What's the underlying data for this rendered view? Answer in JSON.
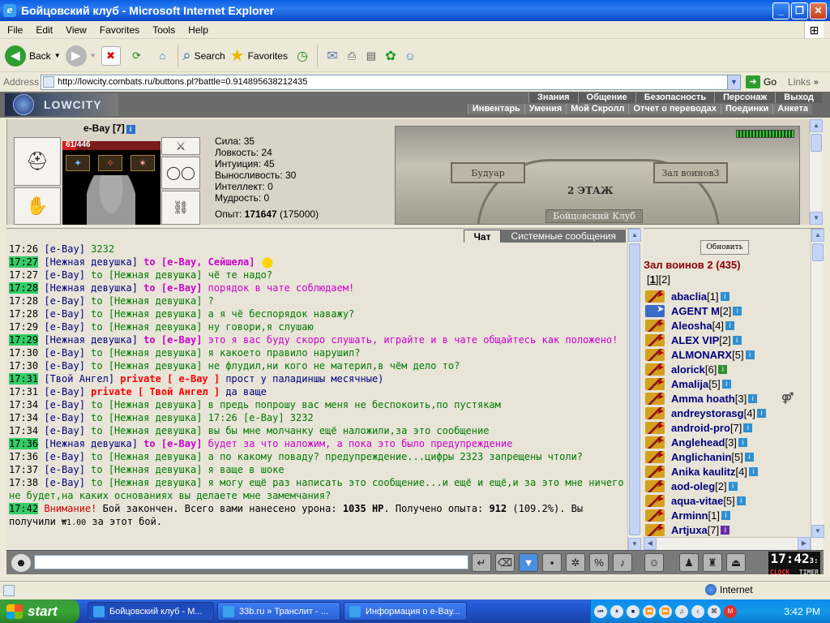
{
  "window": {
    "title": "Бойцовский клуб - Microsoft Internet Explorer",
    "buttons": [
      "_",
      "❐",
      "✕"
    ]
  },
  "menu": [
    "File",
    "Edit",
    "View",
    "Favorites",
    "Tools",
    "Help"
  ],
  "toolbar": {
    "back": "Back",
    "search": "Search",
    "favorites": "Favorites"
  },
  "address": {
    "label": "Address",
    "url": "http://lowcity.combats.ru/buttons.pl?battle=0.914895638212435",
    "go": "Go",
    "links": "Links"
  },
  "game_nav": {
    "logo": "LOWCITY",
    "row1": [
      "Знания",
      "Общение",
      "Безопасность",
      "Персонаж",
      "Выход"
    ],
    "row2": [
      "Инвентарь",
      "Умения",
      "Мой Скролл",
      "Отчет о переводах",
      "Поединки",
      "Анкета"
    ]
  },
  "character": {
    "name": "e-Bay [7]",
    "hp": "61/446",
    "hp_fraction": 0.137,
    "stats": [
      "Сила: 35",
      "Ловкость: 24",
      "Интуиция: 45",
      "Выносливость: 30",
      "Интеллект: 0",
      "Мудрость: 0"
    ],
    "exp_label": "Опыт:",
    "exp_value": "171647",
    "exp_next": "(175000)"
  },
  "room": {
    "door_left": "Будуар",
    "door_right": "Зал воинов3",
    "floor": "2 ЭТАЖ",
    "club": "Бойцовский Клуб"
  },
  "chat_tabs": {
    "chat": "Чат",
    "system": "Системные сообщения"
  },
  "chat": [
    {
      "time": "17:26",
      "hl": false,
      "who": "[e-Bay]",
      "to": " 3232",
      "tostyle": "gr"
    },
    {
      "time": "17:27",
      "hl": true,
      "who": "[Нежная девушка]",
      "to": " to [e-Bay, Сейшела]",
      "tostyle": "tob",
      "smile": true
    },
    {
      "time": "17:27",
      "hl": false,
      "who": "[e-Bay]",
      "to": " to [Нежная девушка] чё те надо?",
      "tostyle": "to"
    },
    {
      "time": "17:28",
      "hl": true,
      "who": "[Нежная девушка]",
      "to": " to [e-Bay]",
      "tostyle": "tob",
      "msg": " порядок в чате соблюдаем!",
      "msgstyle": "mg"
    },
    {
      "time": "17:28",
      "hl": false,
      "who": "[e-Bay]",
      "to": " to [Нежная девушка] ?",
      "tostyle": "to"
    },
    {
      "time": "17:28",
      "hl": false,
      "who": "[e-Bay]",
      "to": " to [Нежная девушка] а я чё беспорядок наважу?",
      "tostyle": "to"
    },
    {
      "time": "17:29",
      "hl": false,
      "who": "[e-Bay]",
      "to": " to [Нежная девушка] ну говори,я слушаю",
      "tostyle": "to"
    },
    {
      "time": "17:29",
      "hl": true,
      "who": "[Нежная девушка]",
      "to": " to [e-Bay]",
      "tostyle": "tob",
      "msg": " это я вас буду скоро слушать, играйте и в чате общайтесь как положено!",
      "msgstyle": "mg"
    },
    {
      "time": "17:30",
      "hl": false,
      "who": "[e-Bay]",
      "to": " to [Нежная девушка] я какоето правило нарушил?",
      "tostyle": "to"
    },
    {
      "time": "17:30",
      "hl": false,
      "who": "[e-Bay]",
      "to": " to [Нежная девушка] не флудил,ни кого не материл,в чём дело то?",
      "tostyle": "to"
    },
    {
      "time": "17:31",
      "hl": true,
      "who": "[Твой Ангел]",
      "private": " private [ e-Bay ]",
      "msg": " прост у паладиншы месячные)",
      "msgstyle": "nk"
    },
    {
      "time": "17:31",
      "hl": false,
      "who": "[e-Bay]",
      "private": " private [ Твой Ангел ]",
      "msg": " да ваще",
      "msgstyle": "nk"
    },
    {
      "time": "17:34",
      "hl": false,
      "who": "[e-Bay]",
      "to": " to [Нежная девушка] в предь попрошу вас меня не беспокоить,по пустякам",
      "tostyle": "to"
    },
    {
      "time": "17:34",
      "hl": false,
      "who": "[e-Bay]",
      "to": " to [Нежная девушка] 17:26 [e-Bay] 3232",
      "tostyle": "to"
    },
    {
      "time": "17:34",
      "hl": false,
      "who": "[e-Bay]",
      "to": " to [Нежная девушка] вы бы мне молчанку ещё наложили,за это сообщение",
      "tostyle": "to"
    },
    {
      "time": "17:36",
      "hl": true,
      "who": "[Нежная девушка]",
      "to": " to [e-Bay]",
      "tostyle": "tob",
      "msg": " будет за что наложим, а пока это было предупреждение",
      "msgstyle": "mg"
    },
    {
      "time": "17:36",
      "hl": false,
      "who": "[e-Bay]",
      "to": " to [Нежная девушка] а по какому поваду? предупреждение...цифры 2323 запрещены чтоли?",
      "tostyle": "to"
    },
    {
      "time": "17:37",
      "hl": false,
      "who": "[e-Bay]",
      "to": " to [Нежная девушка] я ваще в шоке",
      "tostyle": "to"
    },
    {
      "time": "17:38",
      "hl": false,
      "who": "[e-Bay]",
      "to": " to [Нежная девушка] я могу ещё раз написать это сообщение...и ещё и ещё,и за это мне ничего не будет,на каких основаниях вы делаете мне замемчания?",
      "tostyle": "to"
    }
  ],
  "system_msg": {
    "time": "17:42",
    "warn": "Внимание!",
    "text1": " Бой закончен. Всего вами нанесено урона: ",
    "damage": "1035 HP",
    "text2": ". Получено опыта: ",
    "exp": "912",
    "text3": " (109.2%). Вы получили ",
    "money": "₩1.00",
    "text4": " за этот бой."
  },
  "roomlist": {
    "refresh": "Обновить",
    "hall": "Зал воинов 2 (435)",
    "pages": [
      "1",
      "2"
    ],
    "users": [
      {
        "name": "abaclia",
        "lvl": "[1]",
        "info": "i"
      },
      {
        "name": "AGENT M",
        "lvl": "[2]",
        "info": "i",
        "agent": true
      },
      {
        "name": "Aleosha",
        "lvl": "[4]",
        "info": "i"
      },
      {
        "name": "ALEX VIP",
        "lvl": "[2]",
        "info": "i"
      },
      {
        "name": "ALMONARX",
        "lvl": "[5]",
        "info": "i"
      },
      {
        "name": "alorick",
        "lvl": "[6]",
        "info": "i",
        "color": "green"
      },
      {
        "name": "Amalija",
        "lvl": "[5]",
        "info": "i"
      },
      {
        "name": "Amma hoath",
        "lvl": "[3]",
        "info": "i",
        "extra": "⚤"
      },
      {
        "name": "andreystorasg",
        "lvl": "[4]",
        "info": "i"
      },
      {
        "name": "android-pro",
        "lvl": "[7]",
        "info": "i"
      },
      {
        "name": "Anglehead",
        "lvl": "[3]",
        "info": "i"
      },
      {
        "name": "Anglichanin",
        "lvl": "[5]",
        "info": "i"
      },
      {
        "name": "Anika kaulitz",
        "lvl": "[4]",
        "info": "i"
      },
      {
        "name": "aod-oleg",
        "lvl": "[2]",
        "info": "i"
      },
      {
        "name": "aqua-vitae",
        "lvl": "[5]",
        "info": "i"
      },
      {
        "name": "Arminn",
        "lvl": "[1]",
        "info": "i"
      },
      {
        "name": "Artjuxa",
        "lvl": "[7]",
        "info": "i",
        "color": "purple"
      }
    ]
  },
  "clock": {
    "time": "17:42",
    "sec": "3:",
    "clock_label": "CLOCK",
    "timer_label": "TIMER"
  },
  "statusbar": {
    "zone": "Internet"
  },
  "taskbar": {
    "start": "start",
    "tasks": [
      "Бойцовский клуб - M...",
      "33b.ru » Транслит - ...",
      "Информация о e-Bay..."
    ],
    "time": "3:42 PM"
  }
}
